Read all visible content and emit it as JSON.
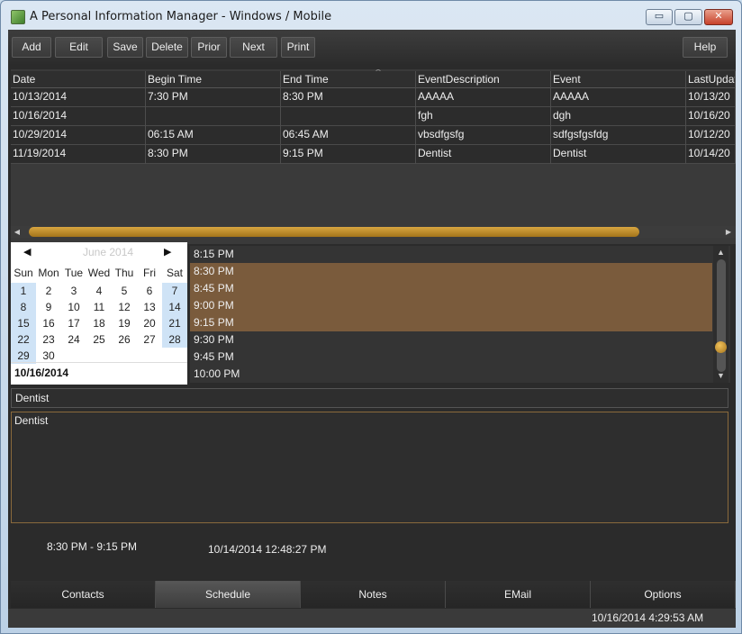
{
  "window": {
    "title": "A Personal Information Manager - Windows / Mobile",
    "controls": {
      "minimize": "▭",
      "maximize": "▢",
      "close": "✕"
    }
  },
  "toolbar": {
    "buttons": [
      "Add",
      "Edit",
      "Save",
      "Delete",
      "Prior",
      "Next",
      "Print"
    ],
    "help": "Help"
  },
  "grid": {
    "columns": [
      "Date",
      "Begin Time",
      "End Time",
      "EventDescription",
      "Event",
      "LastUpdat"
    ],
    "rows": [
      [
        "10/13/2014",
        "7:30 PM",
        " 8:30 PM",
        "AAAAA",
        "AAAAA",
        "10/13/20"
      ],
      [
        "10/16/2014",
        "",
        "",
        "fgh",
        "dgh",
        "10/16/20"
      ],
      [
        "10/29/2014",
        "06:15 AM",
        "06:45 AM",
        "vbsdfgsfg",
        "sdfgsfgsfdg",
        "10/12/20"
      ],
      [
        "11/19/2014",
        " 8:30 PM",
        "9:15 PM",
        "Dentist",
        "Dentist",
        "10/14/20"
      ]
    ]
  },
  "calendar": {
    "prev": "◀",
    "next": "▶",
    "month": "June 2014",
    "days_of_week": [
      "Sun",
      "Mon",
      "Tue",
      "Wed",
      "Thu",
      "Fri",
      "Sat"
    ],
    "weeks": [
      [
        "1",
        "2",
        "3",
        "4",
        "5",
        "6",
        "7"
      ],
      [
        "8",
        "9",
        "10",
        "11",
        "12",
        "13",
        "14"
      ],
      [
        "15",
        "16",
        "17",
        "18",
        "19",
        "20",
        "21"
      ],
      [
        "22",
        "23",
        "24",
        "25",
        "26",
        "27",
        "28"
      ],
      [
        "29",
        "30",
        "",
        "",
        "",
        "",
        ""
      ]
    ],
    "selected_date": "10/16/2014"
  },
  "time_slots": [
    {
      "label": "8:15 PM",
      "selected": false
    },
    {
      "label": "8:30 PM",
      "selected": true
    },
    {
      "label": "8:45 PM",
      "selected": true
    },
    {
      "label": "9:00 PM",
      "selected": true
    },
    {
      "label": "9:15 PM",
      "selected": true
    },
    {
      "label": "9:30 PM",
      "selected": false
    },
    {
      "label": "9:45 PM",
      "selected": false
    },
    {
      "label": "10:00 PM",
      "selected": false
    }
  ],
  "event": {
    "subject": "Dentist",
    "description": "Dentist",
    "time_range": "8:30 PM -  9:15 PM",
    "last_updated": "10/14/2014 12:48:27 PM"
  },
  "tabs": [
    {
      "label": "Contacts",
      "active": false
    },
    {
      "label": "Schedule",
      "active": true
    },
    {
      "label": "Notes",
      "active": false
    },
    {
      "label": "EMail",
      "active": false
    },
    {
      "label": "Options",
      "active": false
    }
  ],
  "status": {
    "datetime": "10/16/2014 4:29:53 AM"
  },
  "colors": {
    "accent": "#c8922e",
    "selection": "#7a5b3c",
    "background": "#2b2b2b"
  }
}
